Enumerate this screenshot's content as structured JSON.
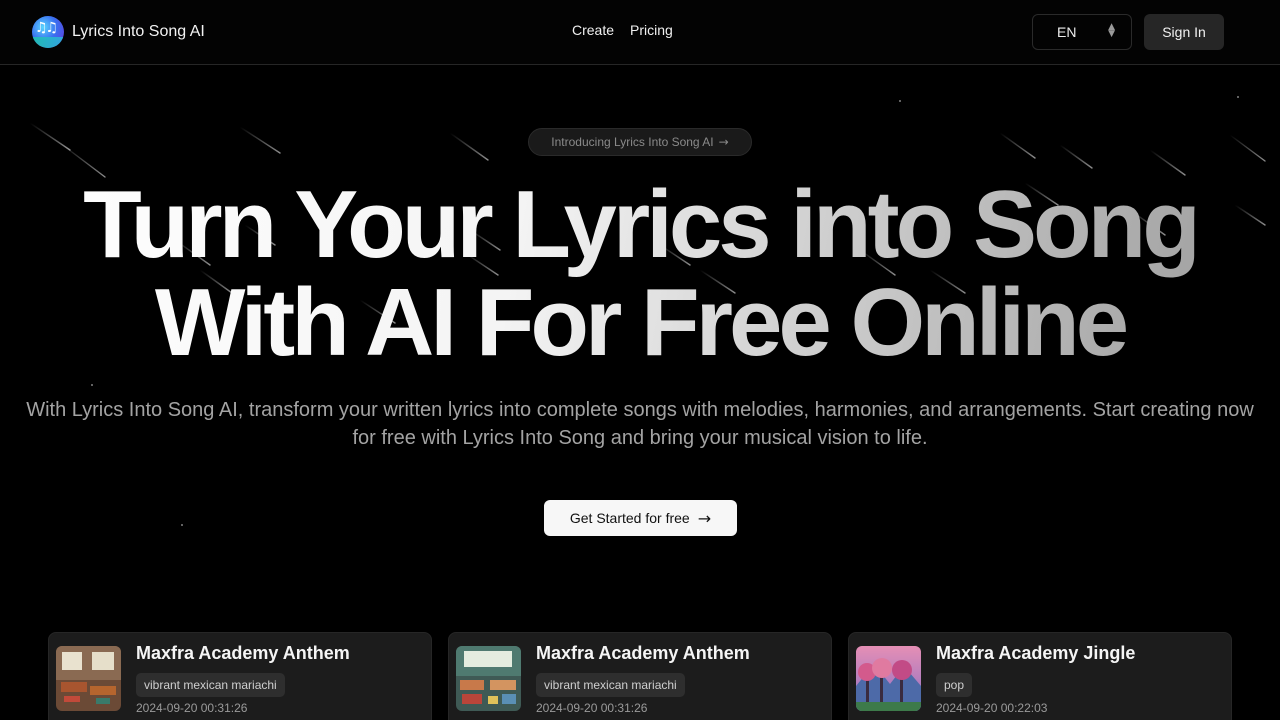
{
  "brand": {
    "name": "Lyrics Into Song AI",
    "logo_icon": "music-notes-logo"
  },
  "nav": {
    "links": [
      "Create",
      "Pricing"
    ]
  },
  "language": {
    "selected": "EN"
  },
  "auth": {
    "sign_in": "Sign In"
  },
  "hero": {
    "badge": "Introducing Lyrics Into Song AI",
    "headline_line1": "Turn Your Lyrics into Song",
    "headline_line2": "With AI For Free Online",
    "subtitle": "With Lyrics Into Song AI, transform your written lyrics into complete songs with melodies, harmonies, and arrangements. Start creating now for free with Lyrics Into Song and bring your musical vision to life.",
    "cta": "Get Started for free"
  },
  "songs": [
    {
      "title": "Maxfra Academy Anthem",
      "tag": "vibrant mexican mariachi",
      "date": "2024-09-20 00:31:26",
      "cover": "classroom-cover"
    },
    {
      "title": "Maxfra Academy Anthem",
      "tag": "vibrant mexican mariachi",
      "date": "2024-09-20 00:31:26",
      "cover": "classroom-cover"
    },
    {
      "title": "Maxfra Academy Jingle",
      "tag": "pop",
      "date": "2024-09-20 00:22:03",
      "cover": "forest-cover"
    }
  ],
  "colors": {
    "background": "#000000",
    "card": "#1c1c1c",
    "cta_bg": "#f7f7f7"
  }
}
